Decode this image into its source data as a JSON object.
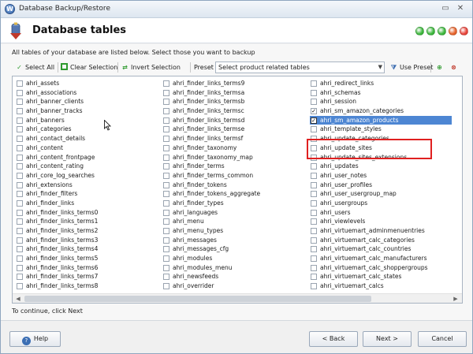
{
  "window": {
    "title": "Database Backup/Restore",
    "minimize_glyph": "▭",
    "close_glyph": "✕"
  },
  "header": {
    "title": "Database tables",
    "dots": [
      "#3cb73c",
      "#3cb73c",
      "#3cb73c",
      "#e6622a",
      "#e8443a"
    ]
  },
  "instruction": "All tables of your database are listed below. Select those you want to backup",
  "toolbar": {
    "select_all": "Select All",
    "clear_selection": "Clear Selection",
    "invert_selection": "Invert Selection",
    "preset_label": "Preset",
    "preset_value": "Select product related tables",
    "use_preset": "Use Preset"
  },
  "tables": {
    "col0": [
      {
        "name": "ahri_assets",
        "checked": false
      },
      {
        "name": "ahri_associations",
        "checked": false
      },
      {
        "name": "ahri_banner_clients",
        "checked": false
      },
      {
        "name": "ahri_banner_tracks",
        "checked": false
      },
      {
        "name": "ahri_banners",
        "checked": false
      },
      {
        "name": "ahri_categories",
        "checked": false
      },
      {
        "name": "ahri_contact_details",
        "checked": false
      },
      {
        "name": "ahri_content",
        "checked": false
      },
      {
        "name": "ahri_content_frontpage",
        "checked": false
      },
      {
        "name": "ahri_content_rating",
        "checked": false
      },
      {
        "name": "ahri_core_log_searches",
        "checked": false
      },
      {
        "name": "ahri_extensions",
        "checked": false
      },
      {
        "name": "ahri_finder_filters",
        "checked": false
      },
      {
        "name": "ahri_finder_links",
        "checked": false
      },
      {
        "name": "ahri_finder_links_terms0",
        "checked": false
      },
      {
        "name": "ahri_finder_links_terms1",
        "checked": false
      },
      {
        "name": "ahri_finder_links_terms2",
        "checked": false
      },
      {
        "name": "ahri_finder_links_terms3",
        "checked": false
      },
      {
        "name": "ahri_finder_links_terms4",
        "checked": false
      },
      {
        "name": "ahri_finder_links_terms5",
        "checked": false
      },
      {
        "name": "ahri_finder_links_terms6",
        "checked": false
      },
      {
        "name": "ahri_finder_links_terms7",
        "checked": false
      },
      {
        "name": "ahri_finder_links_terms8",
        "checked": false
      }
    ],
    "col1": [
      {
        "name": "ahri_finder_links_terms9",
        "checked": false
      },
      {
        "name": "ahri_finder_links_termsa",
        "checked": false
      },
      {
        "name": "ahri_finder_links_termsb",
        "checked": false
      },
      {
        "name": "ahri_finder_links_termsc",
        "checked": false
      },
      {
        "name": "ahri_finder_links_termsd",
        "checked": false
      },
      {
        "name": "ahri_finder_links_termse",
        "checked": false
      },
      {
        "name": "ahri_finder_links_termsf",
        "checked": false
      },
      {
        "name": "ahri_finder_taxonomy",
        "checked": false
      },
      {
        "name": "ahri_finder_taxonomy_map",
        "checked": false
      },
      {
        "name": "ahri_finder_terms",
        "checked": false
      },
      {
        "name": "ahri_finder_terms_common",
        "checked": false
      },
      {
        "name": "ahri_finder_tokens",
        "checked": false
      },
      {
        "name": "ahri_finder_tokens_aggregate",
        "checked": false
      },
      {
        "name": "ahri_finder_types",
        "checked": false
      },
      {
        "name": "ahri_languages",
        "checked": false
      },
      {
        "name": "ahri_menu",
        "checked": false
      },
      {
        "name": "ahri_menu_types",
        "checked": false
      },
      {
        "name": "ahri_messages",
        "checked": false
      },
      {
        "name": "ahri_messages_cfg",
        "checked": false
      },
      {
        "name": "ahri_modules",
        "checked": false
      },
      {
        "name": "ahri_modules_menu",
        "checked": false
      },
      {
        "name": "ahri_newsfeeds",
        "checked": false
      },
      {
        "name": "ahri_overrider",
        "checked": false
      }
    ],
    "col2": [
      {
        "name": "ahri_redirect_links",
        "checked": false
      },
      {
        "name": "ahri_schemas",
        "checked": false
      },
      {
        "name": "ahri_session",
        "checked": false
      },
      {
        "name": "ahri_sm_amazon_categories",
        "checked": true
      },
      {
        "name": "ahri_sm_amazon_products",
        "checked": true,
        "selected": true
      },
      {
        "name": "ahri_template_styles",
        "checked": false
      },
      {
        "name": "ahri_update_categories",
        "checked": false
      },
      {
        "name": "ahri_update_sites",
        "checked": false
      },
      {
        "name": "ahri_update_sites_extensions",
        "checked": false
      },
      {
        "name": "ahri_updates",
        "checked": false
      },
      {
        "name": "ahri_user_notes",
        "checked": false
      },
      {
        "name": "ahri_user_profiles",
        "checked": false
      },
      {
        "name": "ahri_user_usergroup_map",
        "checked": false
      },
      {
        "name": "ahri_usergroups",
        "checked": false
      },
      {
        "name": "ahri_users",
        "checked": false
      },
      {
        "name": "ahri_viewlevels",
        "checked": false
      },
      {
        "name": "ahri_virtuemart_adminmenuentries",
        "checked": false
      },
      {
        "name": "ahri_virtuemart_calc_categories",
        "checked": false
      },
      {
        "name": "ahri_virtuemart_calc_countries",
        "checked": false
      },
      {
        "name": "ahri_virtuemart_calc_manufacturers",
        "checked": false
      },
      {
        "name": "ahri_virtuemart_calc_shoppergroups",
        "checked": false
      },
      {
        "name": "ahri_virtuemart_calc_states",
        "checked": false
      },
      {
        "name": "ahri_virtuemart_calcs",
        "checked": false
      }
    ]
  },
  "continue_text": "To continue, click Next",
  "footer": {
    "help": "Help",
    "back": "< Back",
    "next": "Next >",
    "cancel": "Cancel"
  },
  "colors": {
    "selection": "#4d86d3",
    "highlight_border": "#e02020",
    "select_all_icon": "#2e9a2e",
    "clear_icon": "#2e9a2e"
  }
}
